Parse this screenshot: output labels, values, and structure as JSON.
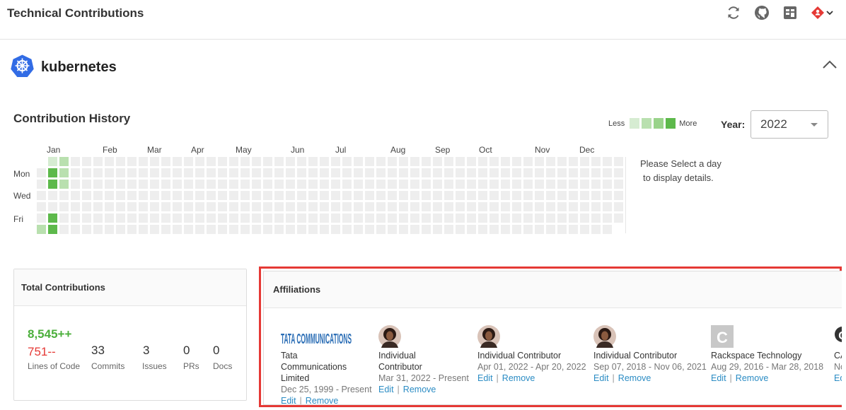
{
  "page": {
    "title": "Technical Contributions"
  },
  "toolbar": {
    "icons": [
      "refresh-icon",
      "github-icon",
      "calendar-grid-icon",
      "user-menu-icon",
      "chevron-down-icon"
    ]
  },
  "project": {
    "name": "kubernetes",
    "logo_icon": "kubernetes-helm-icon"
  },
  "history": {
    "title": "Contribution History",
    "legend_less": "Less",
    "legend_more": "More",
    "legend_colors": [
      "#d6ecd2",
      "#b9e0af",
      "#99d38a",
      "#5db94b"
    ],
    "year_label": "Year:",
    "year_value": "2022",
    "months": [
      "Jan",
      "Feb",
      "Mar",
      "Apr",
      "May",
      "Jun",
      "Jul",
      "Aug",
      "Sep",
      "Oct",
      "Nov",
      "Dec"
    ],
    "day_labels": [
      "Mon",
      "Wed",
      "Fri"
    ],
    "hint_line1": "Please Select a day",
    "hint_line2": "to display details.",
    "empty_color": "#eeeeee"
  },
  "totals": {
    "title": "Total Contributions",
    "lines_added": "8,545++",
    "lines_removed": "751--",
    "lines_label": "Lines of Code",
    "commits": "33",
    "commits_label": "Commits",
    "issues": "3",
    "issues_label": "Issues",
    "prs": "0",
    "prs_label": "PRs",
    "docs": "0",
    "docs_label": "Docs",
    "colors": {
      "added": "#4caf3c",
      "removed": "#e53935"
    }
  },
  "affiliations": {
    "title": "Affiliations",
    "edit_label": "Edit",
    "remove_label": "Remove",
    "separator": "|",
    "logo_text": "TATA COMMUNICATIONS",
    "items": [
      {
        "name_lines": [
          "Tata",
          "Communications",
          "Limited"
        ],
        "dates": "Dec 25, 1999 - Present",
        "logo": "tata-logo"
      },
      {
        "name_lines": [
          "Individual",
          "Contributor"
        ],
        "dates": "Mar 31, 2022 - Present",
        "logo": "avatar"
      },
      {
        "name_lines": [
          "Individual Contributor"
        ],
        "dates": "Apr 01, 2022 - Apr 20, 2022",
        "logo": "avatar"
      },
      {
        "name_lines": [
          "Individual Contributor"
        ],
        "dates": "Sep 07, 2018 - Nov 06, 2021",
        "logo": "avatar"
      },
      {
        "name_lines": [
          "Rackspace Technology"
        ],
        "dates": "Aug 29, 2016 - Mar 28, 2018",
        "logo": "letter-c"
      },
      {
        "name_lines": [
          "CA"
        ],
        "dates": "Nov",
        "logo": "letter-c-round"
      }
    ]
  }
}
